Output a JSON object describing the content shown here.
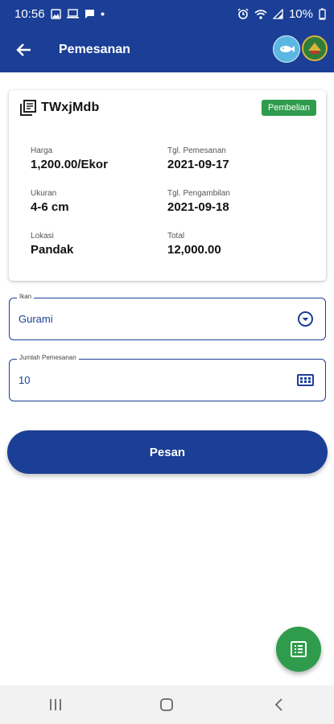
{
  "status_bar": {
    "time": "10:56",
    "battery": "10%"
  },
  "app_bar": {
    "title": "Pemesanan"
  },
  "order": {
    "code": "TWxjMdb",
    "badge": "Pembelian",
    "harga_label": "Harga",
    "harga": "1,200.00/Ekor",
    "tgl_pemesanan_label": "Tgl. Pemesanan",
    "tgl_pemesanan": "2021-09-17",
    "ukuran_label": "Ukuran",
    "ukuran": "4-6 cm",
    "tgl_pengambilan_label": "Tgl. Pengambilan",
    "tgl_pengambilan": "2021-09-18",
    "lokasi_label": "Lokasi",
    "lokasi": "Pandak",
    "total_label": "Total",
    "total": "12,000.00"
  },
  "form": {
    "ikan_label": "Ikan",
    "ikan_value": "Gurami",
    "jumlah_label": "Jumlah Pemesanan",
    "jumlah_value": "10"
  },
  "submit_label": "Pesan",
  "colors": {
    "primary": "#1b3f96",
    "accent": "#2e9c4c"
  }
}
